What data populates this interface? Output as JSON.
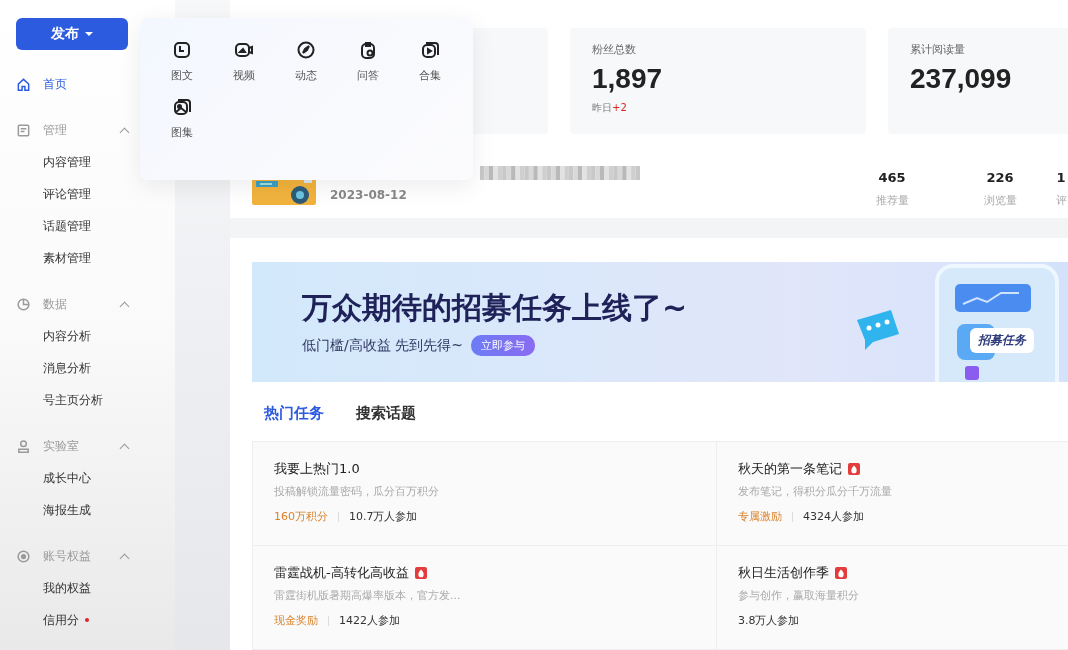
{
  "publish_button": {
    "label": "发布"
  },
  "publish_menu": [
    {
      "label": "图文"
    },
    {
      "label": "视频"
    },
    {
      "label": "动态"
    },
    {
      "label": "问答"
    },
    {
      "label": "合集"
    },
    {
      "label": "图集"
    }
  ],
  "sidebar": [
    {
      "label": "首页",
      "selected": true
    },
    {
      "label": "管理",
      "selected": false,
      "expanded": true,
      "children": [
        {
          "label": "内容管理",
          "dot": false
        },
        {
          "label": "评论管理",
          "dot": false
        },
        {
          "label": "话题管理",
          "dot": false
        },
        {
          "label": "素材管理",
          "dot": false
        }
      ]
    },
    {
      "label": "数据",
      "selected": false,
      "expanded": true,
      "children": [
        {
          "label": "内容分析",
          "dot": false
        },
        {
          "label": "消息分析",
          "dot": false
        },
        {
          "label": "号主页分析",
          "dot": false
        }
      ]
    },
    {
      "label": "实验室",
      "selected": false,
      "expanded": true,
      "children": [
        {
          "label": "成长中心",
          "dot": false
        },
        {
          "label": "海报生成",
          "dot": false
        }
      ]
    },
    {
      "label": "账号权益",
      "selected": false,
      "expanded": true,
      "children": [
        {
          "label": "我的权益",
          "dot": false
        },
        {
          "label": "信用分",
          "dot": true
        }
      ]
    }
  ],
  "stats": [
    {
      "kind": "covered"
    },
    {
      "kind": "stat",
      "label": "粉丝总数",
      "value": "1,897",
      "delta_label": "昨日",
      "delta": "+2"
    },
    {
      "kind": "stat",
      "label": "累计阅读量",
      "value": "237,099"
    }
  ],
  "recent_article": {
    "date": "2023-08-12",
    "metrics": [
      {
        "value": "465",
        "label": "推荐量"
      },
      {
        "value": "226",
        "label": "浏览量"
      },
      {
        "value": "1",
        "label": "评"
      }
    ]
  },
  "banner": {
    "title": "万众期待的招募任务上线了~",
    "subtitle": "低门槛/高收益 先到先得~",
    "button": "立即参与",
    "tag": "招募任务"
  },
  "tabs": [
    {
      "label": "热门任务",
      "selected": true
    },
    {
      "label": "搜索话题",
      "selected": false
    }
  ],
  "tasks": [
    {
      "title": "我要上热门1.0",
      "hot": false,
      "desc": "投稿解锁流量密码，瓜分百万积分",
      "reward": "160万积分",
      "participants": "10.7万人参加"
    },
    {
      "title": "秋天的第一条笔记",
      "hot": true,
      "desc": "发布笔记，得积分瓜分千万流量",
      "reward": "专属激励",
      "participants": "4324人参加"
    },
    {
      "title": "雷霆战机-高转化高收益",
      "hot": true,
      "desc": "雷霆街机版暑期高爆率版本，官方发...",
      "reward": "现金奖励",
      "participants": "1422人参加"
    },
    {
      "title": "秋日生活创作季",
      "hot": true,
      "desc": "参与创作，赢取海量积分",
      "participants": "3.8万人参加"
    }
  ]
}
